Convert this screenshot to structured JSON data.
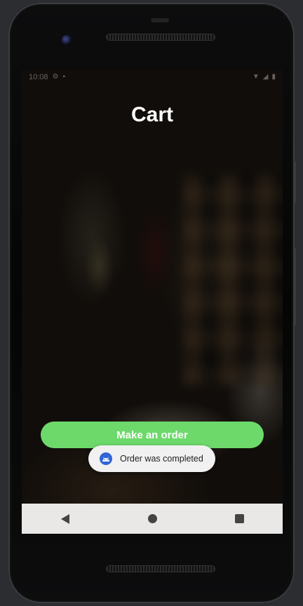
{
  "status_bar": {
    "time": "10:08",
    "icons": [
      "settings-icon",
      "lock-icon",
      "wifi-icon",
      "battery-icon"
    ]
  },
  "screen": {
    "title": "Cart",
    "order_button_label": "Make an order"
  },
  "toast": {
    "message": "Order was completed",
    "icon": "android-icon"
  },
  "nav_bar": {
    "items": [
      "back-icon",
      "home-icon",
      "recent-apps-icon"
    ]
  },
  "colors": {
    "order_button": "#6dd96b",
    "toast_background": "#f1f1f1",
    "toast_icon": "#2f66d6",
    "nav_bar": "#e9e8e7"
  }
}
